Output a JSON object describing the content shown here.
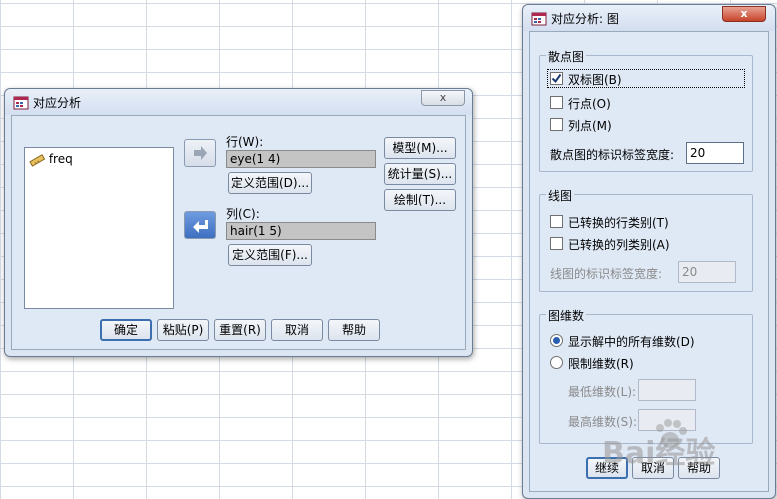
{
  "dialog1": {
    "title": "对应分析",
    "close_label": "x",
    "variables": [
      {
        "name": "freq"
      }
    ],
    "row_label": "行(W):",
    "row_value": "eye(1 4)",
    "row_range_button": "定义范围(D)...",
    "col_label": "列(C):",
    "col_value": "hair(1 5)",
    "col_range_button": "定义范围(F)...",
    "model_button": "模型(M)...",
    "stats_button": "统计量(S)...",
    "plots_button": "绘制(T)...",
    "ok_button": "确定",
    "paste_button": "粘贴(P)",
    "reset_button": "重置(R)",
    "cancel_button": "取消",
    "help_button": "帮助"
  },
  "dialog2": {
    "title": "对应分析: 图",
    "close_label": "x",
    "scatter": {
      "title": "散点图",
      "biplot": "双标图(B)",
      "row_points": "行点(O)",
      "col_points": "列点(M)",
      "label_width_label": "散点图的标识标签宽度:",
      "label_width_value": "20"
    },
    "line": {
      "title": "线图",
      "trans_row": "已转换的行类别(T)",
      "trans_col": "已转换的列类别(A)",
      "label_width_label": "线图的标识标签宽度:",
      "label_width_value": "20"
    },
    "dims": {
      "title": "图维数",
      "all_dims": "显示解中的所有维数(D)",
      "restrict": "限制维数(R)",
      "min_label": "最低维数(L):",
      "max_label": "最高维数(S):"
    },
    "continue_button": "继续",
    "cancel_button": "取消",
    "help_button": "帮助"
  },
  "watermark": "Bai经验"
}
